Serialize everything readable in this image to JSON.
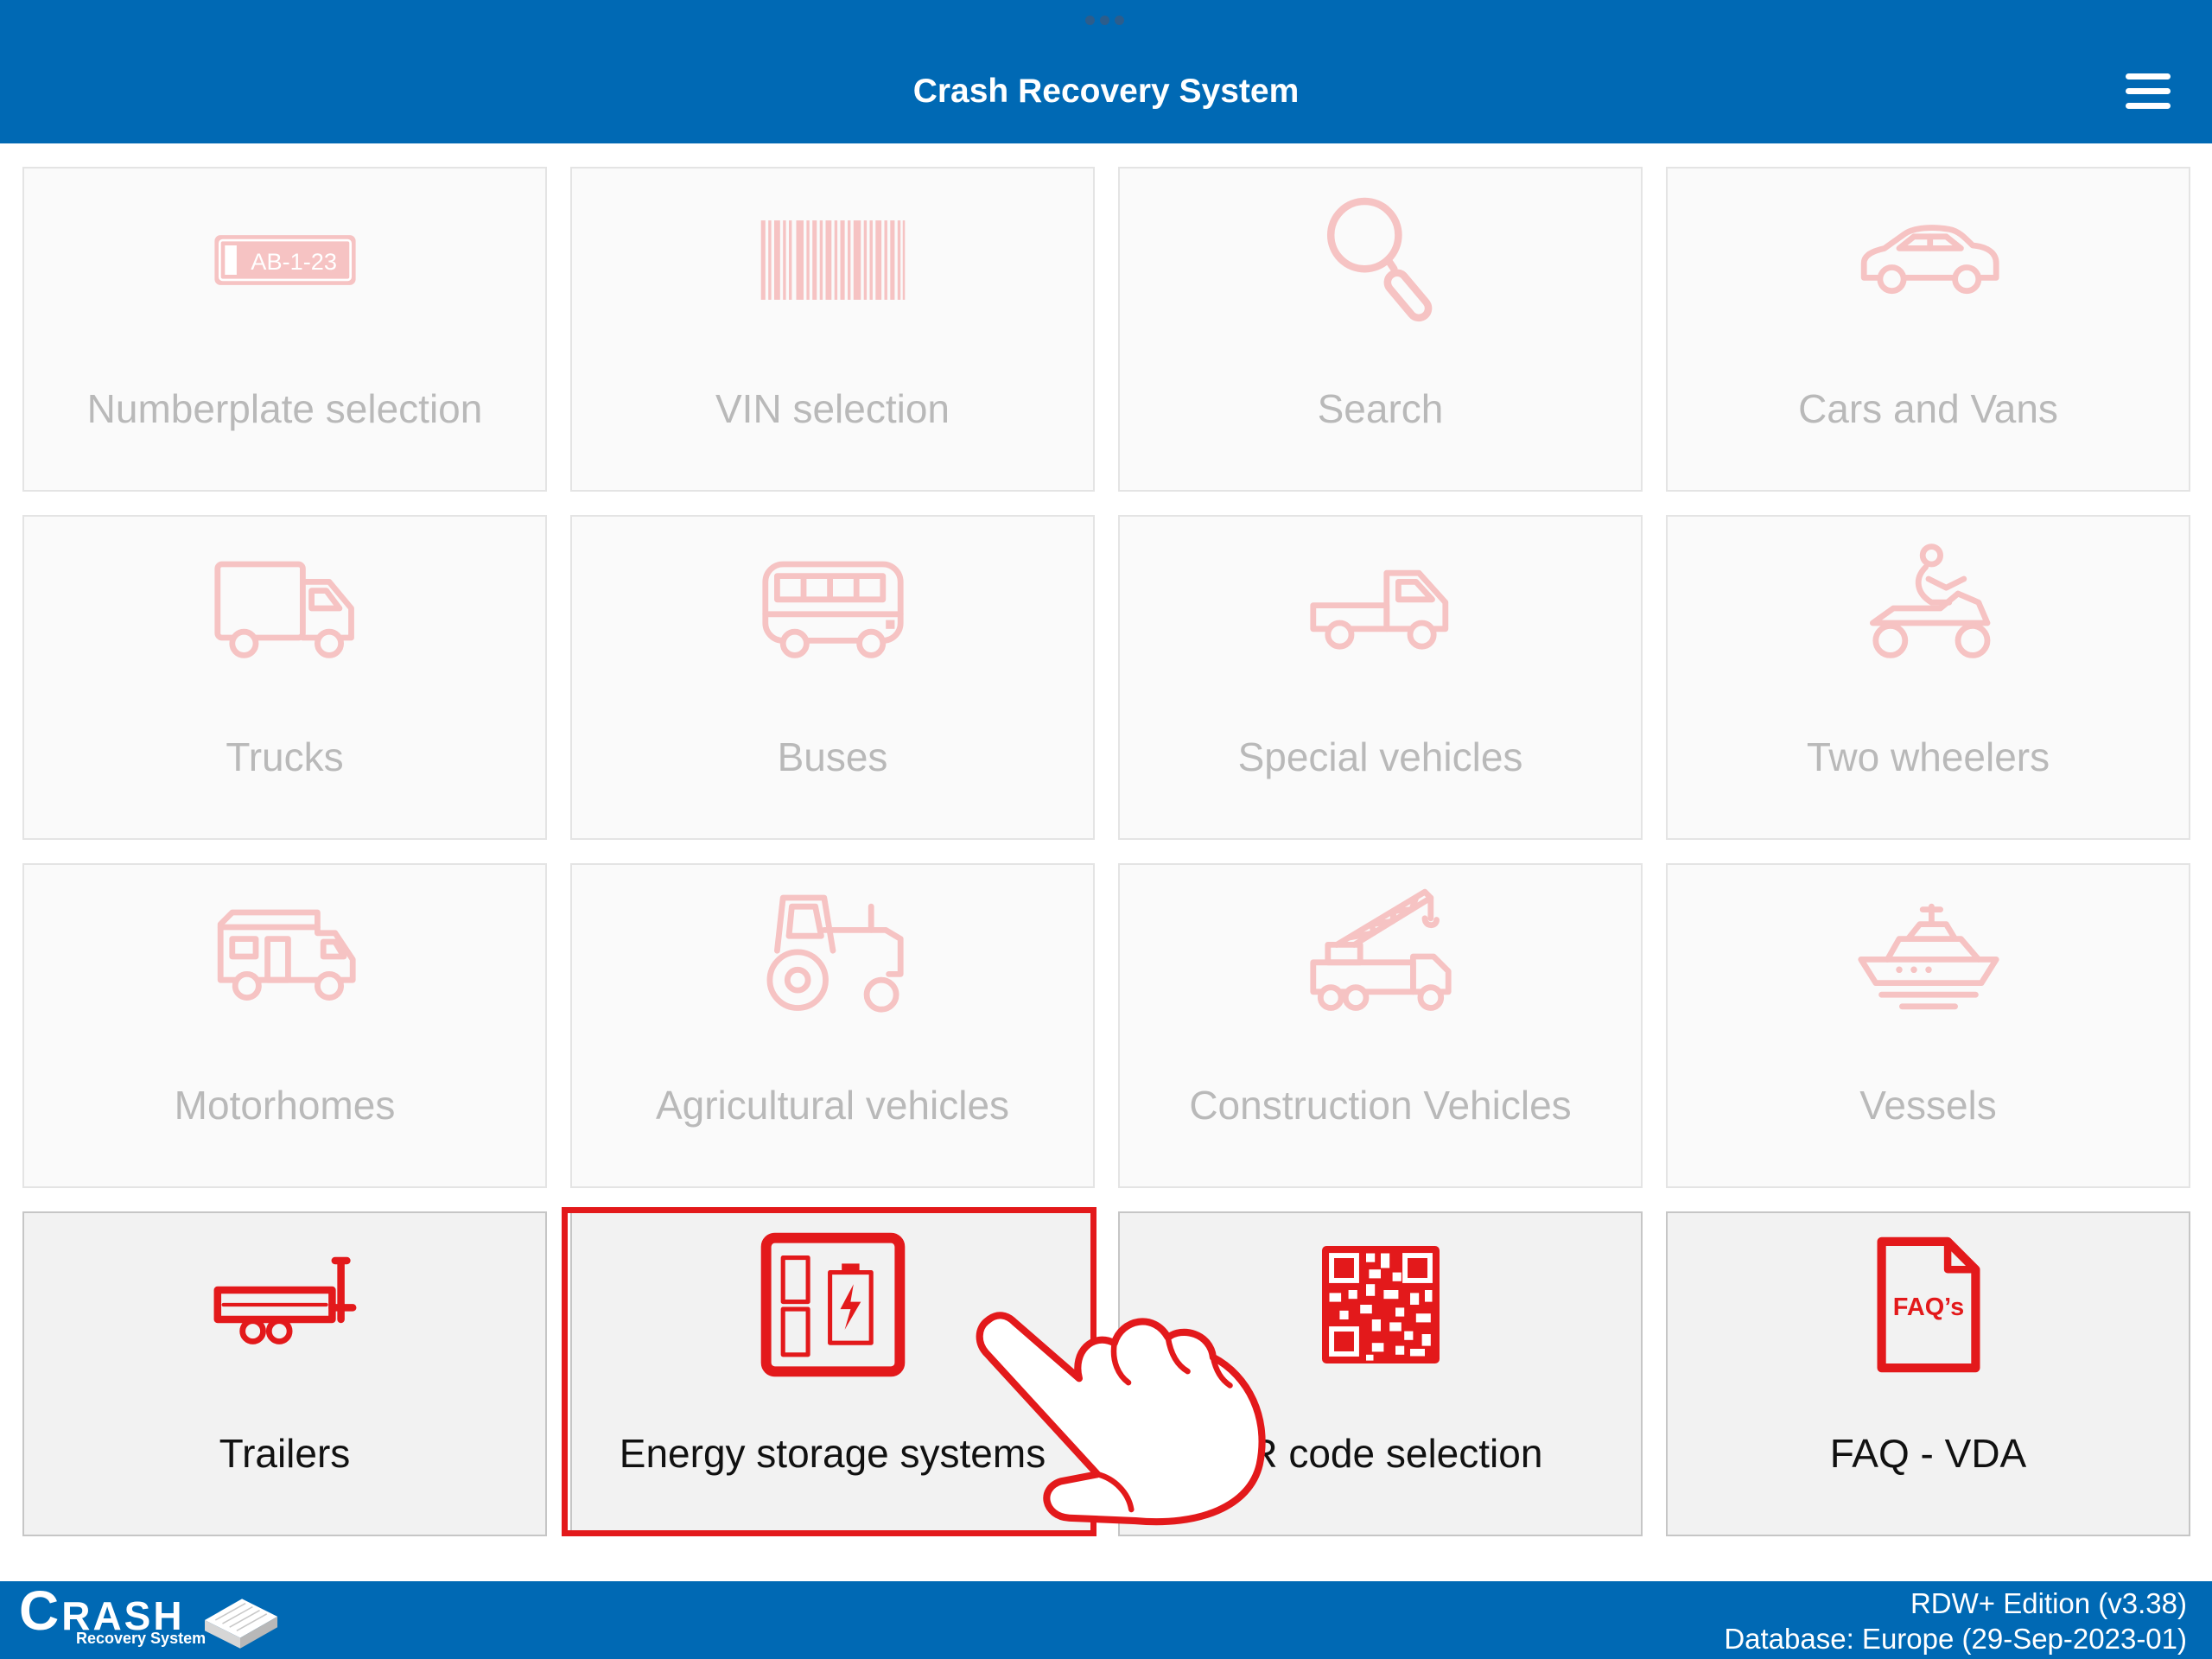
{
  "colors": {
    "brand_blue": "#0069b4",
    "accent_red": "#e3191b",
    "disabled_icon": "#f6c3c3",
    "disabled_text": "#b9b9b9"
  },
  "header": {
    "title": "Crash Recovery System",
    "menu_icon": "hamburger-menu-icon"
  },
  "tiles": [
    {
      "label": "Numberplate selection",
      "icon": "numberplate-icon",
      "icon_text": "AB-1-23",
      "enabled": false
    },
    {
      "label": "VIN selection",
      "icon": "barcode-icon",
      "enabled": false
    },
    {
      "label": "Search",
      "icon": "search-icon",
      "enabled": false
    },
    {
      "label": "Cars and Vans",
      "icon": "car-icon",
      "enabled": false
    },
    {
      "label": "Trucks",
      "icon": "truck-icon",
      "enabled": false
    },
    {
      "label": "Buses",
      "icon": "bus-icon",
      "enabled": false
    },
    {
      "label": "Special vehicles",
      "icon": "pickup-truck-icon",
      "enabled": false
    },
    {
      "label": "Two wheelers",
      "icon": "quad-bike-icon",
      "enabled": false
    },
    {
      "label": "Motorhomes",
      "icon": "motorhome-icon",
      "enabled": false
    },
    {
      "label": "Agricultural vehicles",
      "icon": "tractor-icon",
      "enabled": false
    },
    {
      "label": "Construction Vehicles",
      "icon": "crane-truck-icon",
      "enabled": false
    },
    {
      "label": "Vessels",
      "icon": "boat-icon",
      "enabled": false
    },
    {
      "label": "Trailers",
      "icon": "trailer-icon",
      "enabled": true
    },
    {
      "label": "Energy storage systems",
      "icon": "battery-storage-icon",
      "enabled": true,
      "highlighted": true
    },
    {
      "label": "QR code selection",
      "icon": "qr-code-icon",
      "enabled": true
    },
    {
      "label": "FAQ - VDA",
      "icon": "faq-document-icon",
      "icon_text": "FAQ’s",
      "enabled": true
    }
  ],
  "overlay": {
    "pointer_icon": "hand-pointer-icon"
  },
  "footer": {
    "logo_text": "CRASH",
    "logo_subtext": "Recovery System",
    "logo_icon": "box-logo-icon",
    "edition": "RDW+ Edition (v3.38)",
    "database": "Database: Europe (29-Sep-2023-01)"
  }
}
